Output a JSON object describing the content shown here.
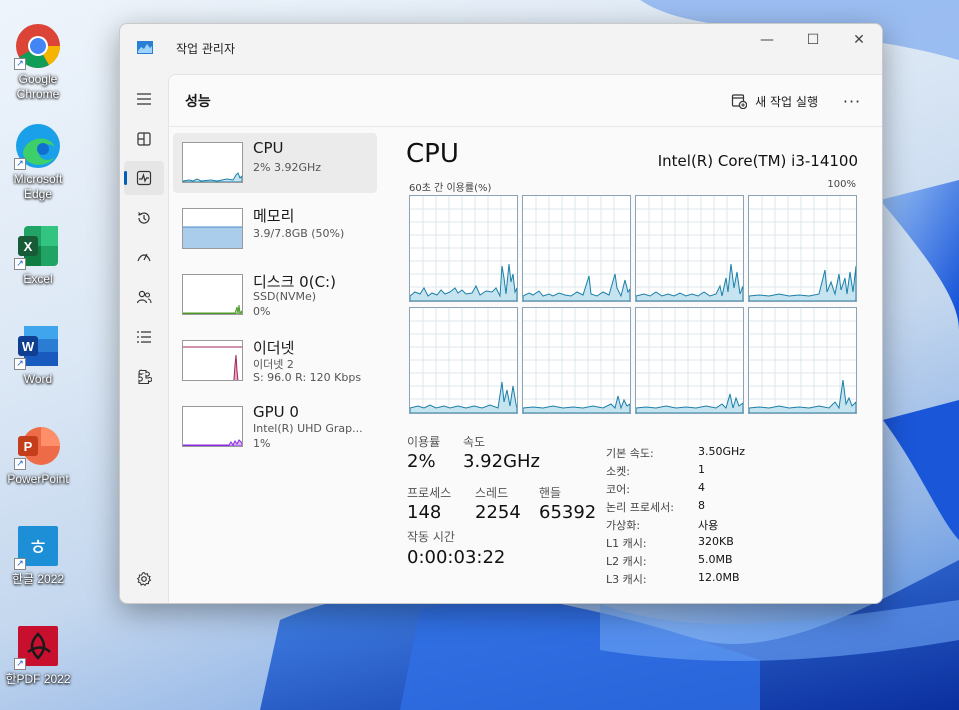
{
  "desktop": {
    "icons": [
      {
        "label": "Google\nChrome",
        "icon": "chrome-icon"
      },
      {
        "label": "Microsoft\nEdge",
        "icon": "edge-icon"
      },
      {
        "label": "Excel",
        "icon": "excel-icon"
      },
      {
        "label": "Word",
        "icon": "word-icon"
      },
      {
        "label": "PowerPoint",
        "icon": "powerpoint-icon"
      },
      {
        "label": "한글 2022",
        "icon": "hangul-icon"
      },
      {
        "label": "한PDF 2022",
        "icon": "hanpdf-icon"
      }
    ]
  },
  "window": {
    "title": "작업 관리자",
    "controls": {
      "minimize": "—",
      "maximize": "☐",
      "close": "✕"
    }
  },
  "nav": {
    "items": [
      {
        "name": "hamburger-icon",
        "glyph": "☰"
      },
      {
        "name": "processes-icon",
        "glyph": "▦"
      },
      {
        "name": "performance-icon",
        "glyph": "∿",
        "active": true
      },
      {
        "name": "history-icon",
        "glyph": "↺"
      },
      {
        "name": "startup-icon",
        "glyph": "↗"
      },
      {
        "name": "users-icon",
        "glyph": "👥"
      },
      {
        "name": "details-icon",
        "glyph": "≡"
      },
      {
        "name": "services-icon",
        "glyph": "⚙"
      }
    ],
    "settings_glyph": "⚙"
  },
  "header": {
    "title": "성능",
    "run_task_label": "새 작업 실행",
    "more_label": "···"
  },
  "resources": [
    {
      "name": "CPU",
      "sub1": "2% 3.92GHz",
      "sub2": "",
      "sub3": ""
    },
    {
      "name": "메모리",
      "sub1": "3.9/7.8GB (50%)",
      "sub2": "",
      "sub3": ""
    },
    {
      "name": "디스크 0(C:)",
      "sub1": "SSD(NVMe)",
      "sub2": "0%",
      "sub3": ""
    },
    {
      "name": "이더넷",
      "sub1": "이더넷 2",
      "sub2": "S: 96.0 R: 120 Kbps",
      "sub3": ""
    },
    {
      "name": "GPU 0",
      "sub1": "Intel(R) UHD Grap...",
      "sub2": "1%",
      "sub3": ""
    }
  ],
  "detail": {
    "title": "CPU",
    "model": "Intel(R) Core(TM) i3-14100",
    "graph_left_label": "60초 간 이용률(%)",
    "graph_right_label": "100%",
    "stats": {
      "utilization_label": "이용률",
      "utilization": "2%",
      "speed_label": "속도",
      "speed": "3.92GHz",
      "processes_label": "프로세스",
      "processes": "148",
      "threads_label": "스레드",
      "threads": "2254",
      "handles_label": "핸들",
      "handles": "65392",
      "uptime_label": "작동 시간",
      "uptime": "0:00:03:22"
    },
    "info": [
      {
        "k": "기본 속도:",
        "v": "3.50GHz"
      },
      {
        "k": "소켓:",
        "v": "1"
      },
      {
        "k": "코어:",
        "v": "4"
      },
      {
        "k": "논리 프로세서:",
        "v": "8"
      },
      {
        "k": "가상화:",
        "v": "사용"
      },
      {
        "k": "L1 캐시:",
        "v": "320KB"
      },
      {
        "k": "L2 캐시:",
        "v": "5.0MB"
      },
      {
        "k": "L3 캐시:",
        "v": "12.0MB"
      }
    ]
  },
  "colors": {
    "accent": "#005fb8",
    "cpu_line": "#1b7fa8",
    "cpu_fill": "#c5e4f0",
    "memory_fill": "#a9cdea",
    "disk": "#4d9a2a",
    "ethernet": "#a0255b",
    "gpu": "#8a2be2"
  }
}
